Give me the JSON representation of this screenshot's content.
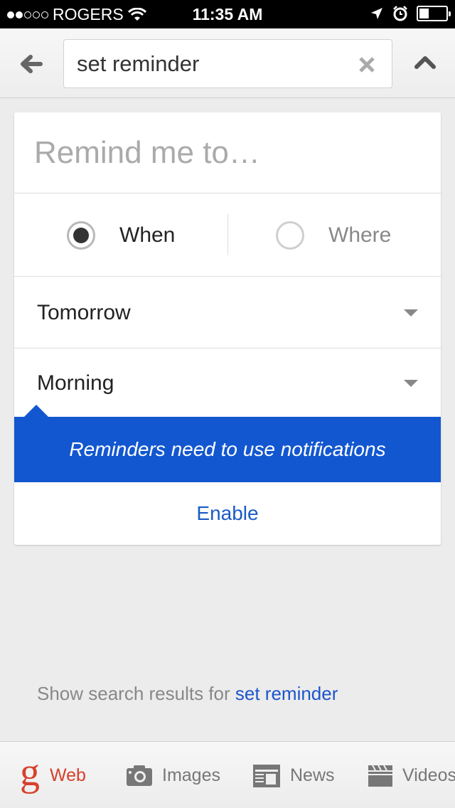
{
  "status_bar": {
    "signal_bars_filled": 2,
    "signal_bars_total": 5,
    "carrier": "ROGERS",
    "time": "11:35 AM",
    "battery_level": 0.35,
    "icons": [
      "wifi-icon",
      "location-icon",
      "alarm-icon",
      "battery-icon"
    ]
  },
  "header": {
    "back_icon": "arrow-left-icon",
    "search_value": "set reminder",
    "clear_icon": "close-icon",
    "collapse_icon": "chevron-up-icon"
  },
  "reminder_card": {
    "title_placeholder": "Remind me to…",
    "trigger_options": [
      {
        "label": "When",
        "selected": true
      },
      {
        "label": "Where",
        "selected": false
      }
    ],
    "date_dropdown": "Tomorrow",
    "time_dropdown": "Morning",
    "notice": "Reminders need to use notifications",
    "enable_label": "Enable"
  },
  "show_results": {
    "prefix": "Show search results for ",
    "query_link": "set reminder"
  },
  "bottom_tabs": [
    {
      "label": "Web",
      "icon": "google-g-icon",
      "active": true
    },
    {
      "label": "Images",
      "icon": "camera-icon",
      "active": false
    },
    {
      "label": "News",
      "icon": "newspaper-icon",
      "active": false
    },
    {
      "label": "Videos",
      "icon": "clapperboard-icon",
      "active": false
    }
  ],
  "colors": {
    "accent_blue": "#1357d0",
    "link_blue": "#1c55cc",
    "active_tab_red": "#d6412c"
  }
}
